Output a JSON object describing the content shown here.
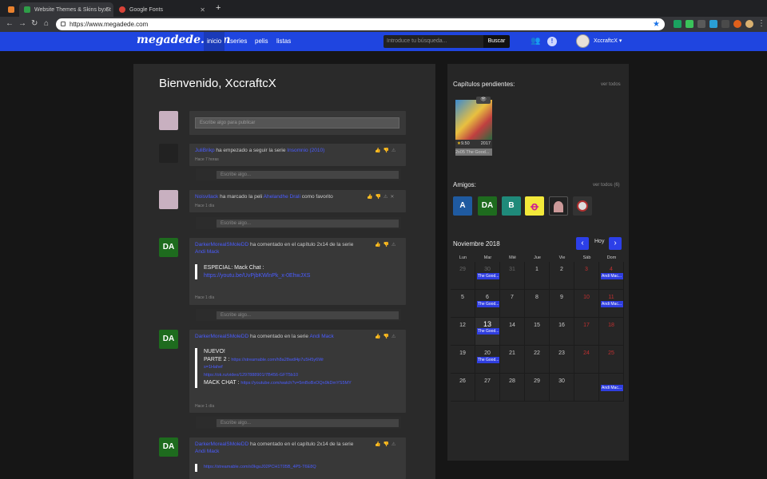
{
  "browser": {
    "tabs": [
      {
        "title": "",
        "favicon_color": "#e8812e"
      },
      {
        "title": "Website Themes & Skins by St",
        "favicon_color": "#2e9e48"
      },
      {
        "title": "Google Fonts",
        "favicon_color": "#d94338"
      }
    ],
    "url": "https://www.megadede.com"
  },
  "header": {
    "logo": "megadede.com",
    "menu": [
      "inicio",
      "series",
      "pelis",
      "listas"
    ],
    "search_placeholder": "Introduce tu búsqueda...",
    "search_button": "Buscar",
    "username": "XccraftcX",
    "accent": "#1f45e0"
  },
  "feed": {
    "welcome": "Bienvenido, XccraftcX",
    "post_placeholder": "Escribe algo para publicar",
    "comment_placeholder": "Escribe algo...",
    "items": [
      {
        "user": "JuliBrikp",
        "action": "ha empezado a seguir la serie",
        "target": "Insomnio (2010)",
        "time": "Hace 7 horas"
      },
      {
        "user": "Noisvllack",
        "action": "ha marcado la peli",
        "target": "Ahelandhe Drali",
        "suffix": "como favorito",
        "time": "Hace 1 día"
      },
      {
        "user": "DarkerMorealSMoleDD",
        "action": "ha comentado en el capítulo 2x14 de la serie",
        "target": "Andi Mack",
        "quote_title": "ESPECIAL: Mack Chat :",
        "quote_link": "https://youtu.be/UvPjbKWlnPk_x-0EhwJXS",
        "time": "Hace 1 día"
      },
      {
        "user": "DarkerMorealSMoleDD",
        "action": "ha comentado en la serie",
        "target": "Andi Mack",
        "quote_lines": [
          "NUEVO!",
          "PARTE 2 :",
          "MACK CHAT :"
        ],
        "quote_links": [
          "https://streamable.com/h8a28wdl4p7u5H5y6Wr",
          "s=1Hahef",
          "https://ok.ru/video/1297888901/7B456-GFT5b10",
          "https://youtube.com/watch?v=5mBoBxOQn9kDmYS5MY"
        ],
        "time": "Hace 1 día"
      },
      {
        "user": "DarkerMorealSMoleDD",
        "action": "ha comentado en el capítulo 2x14 de la serie",
        "target": "Andi Mack",
        "quote_link": "https://streamable.com/s0kguJ02PCH1T05B_4P5-T6E8Q"
      }
    ]
  },
  "pending": {
    "title": "Capítulos pendientes:",
    "see_all": "ver todos",
    "rating": "9.50",
    "year": "2017",
    "episode": "2x05 The Good..."
  },
  "friends": {
    "title": "Amigos:",
    "see_all": "ver todos (6)",
    "items": [
      {
        "label": "A",
        "color": "#1f5aa0"
      },
      {
        "label": "DA",
        "color": "#1e6b1e"
      },
      {
        "label": "B",
        "color": "#1f8a7a"
      },
      {
        "label": "",
        "color": "#f2e83a"
      },
      {
        "label": "",
        "color": "#222222"
      },
      {
        "label": "",
        "color": "#333333"
      }
    ]
  },
  "calendar": {
    "month": "Noviembre 2018",
    "today_label": "Hoy",
    "weekdays": [
      "Lun",
      "Mar",
      "Mié",
      "Jue",
      "Vie",
      "Sáb",
      "Dom"
    ],
    "days": [
      "29",
      "30",
      "31",
      "1",
      "2",
      "3",
      "4",
      "5",
      "6",
      "7",
      "8",
      "9",
      "10",
      "11",
      "12",
      "13",
      "14",
      "15",
      "16",
      "17",
      "18",
      "19",
      "20",
      "21",
      "22",
      "23",
      "24",
      "25",
      "26",
      "27",
      "28",
      "29",
      "30",
      "",
      ""
    ],
    "events": [
      "The Good...",
      "Andi Mac..."
    ]
  }
}
